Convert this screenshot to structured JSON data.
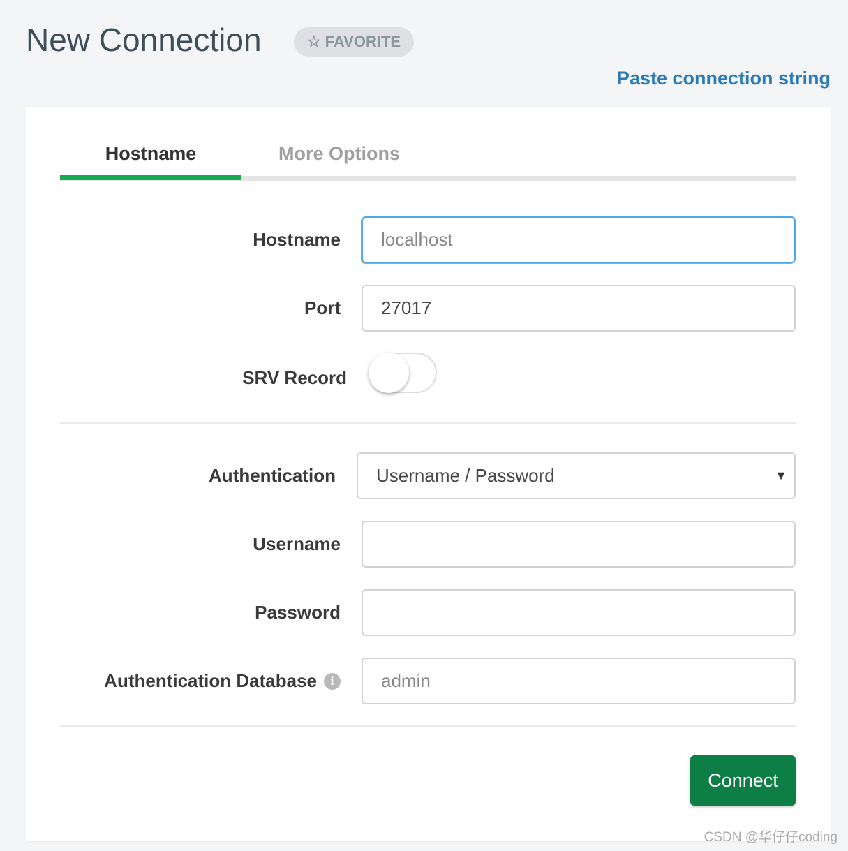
{
  "header": {
    "title": "New Connection",
    "favorite_label": "FAVORITE",
    "paste_link": "Paste connection string"
  },
  "tabs": [
    {
      "label": "Hostname",
      "active": true
    },
    {
      "label": "More Options",
      "active": false
    }
  ],
  "form": {
    "hostname": {
      "label": "Hostname",
      "placeholder": "localhost",
      "value": ""
    },
    "port": {
      "label": "Port",
      "value": "27017"
    },
    "srv": {
      "label": "SRV Record",
      "enabled": false
    },
    "authentication": {
      "label": "Authentication",
      "selected": "Username / Password"
    },
    "username": {
      "label": "Username",
      "value": ""
    },
    "password": {
      "label": "Password",
      "value": ""
    },
    "auth_db": {
      "label": "Authentication Database",
      "placeholder": "admin",
      "value": ""
    }
  },
  "connect_label": "Connect",
  "watermark": "CSDN @华仔仔coding",
  "colors": {
    "accent": "#13aa52",
    "button": "#0d7e46",
    "link": "#2c7bb6"
  }
}
